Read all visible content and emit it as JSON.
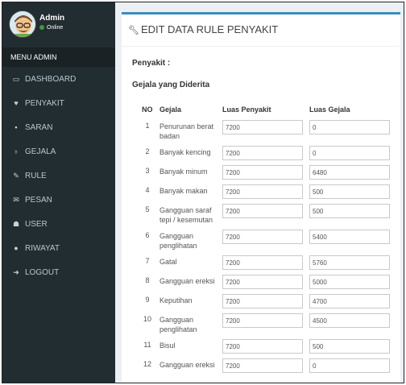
{
  "user": {
    "name": "Admin",
    "status": "Online"
  },
  "menu": {
    "header": "MENU ADMIN",
    "items": [
      {
        "label": "DASHBOARD",
        "icon": "monitor-icon",
        "glyph": "▭"
      },
      {
        "label": "PENYAKIT",
        "icon": "heartbeat-icon",
        "glyph": "♥"
      },
      {
        "label": "SARAN",
        "icon": "briefcase-icon",
        "glyph": "▪"
      },
      {
        "label": "GEJALA",
        "icon": "stethoscope-icon",
        "glyph": "♁"
      },
      {
        "label": "RULE",
        "icon": "wrench-icon",
        "glyph": "✎"
      },
      {
        "label": "PESAN",
        "icon": "envelope-icon",
        "glyph": "✉"
      },
      {
        "label": "USER",
        "icon": "users-icon",
        "glyph": "☗"
      },
      {
        "label": "RIWAYAT",
        "icon": "circle-icon",
        "glyph": "●"
      },
      {
        "label": "LOGOUT",
        "icon": "sign-out-icon",
        "glyph": "➜"
      }
    ]
  },
  "page": {
    "title": "EDIT DATA RULE PENYAKIT",
    "penyakit_label": "Penyakit :",
    "gejala_label": "Gejala yang Diderita"
  },
  "table": {
    "headers": [
      "NO",
      "Gejala",
      "Luas Penyakit",
      "Luas Gejala"
    ],
    "rows": [
      {
        "no": "1",
        "gejala": "Penurunan berat badan",
        "luas_penyakit": "7200",
        "luas_gejala": "0"
      },
      {
        "no": "2",
        "gejala": "Banyak kencing",
        "luas_penyakit": "7200",
        "luas_gejala": "0"
      },
      {
        "no": "3",
        "gejala": "Banyak minum",
        "luas_penyakit": "7200",
        "luas_gejala": "6480"
      },
      {
        "no": "4",
        "gejala": "Banyak makan",
        "luas_penyakit": "7200",
        "luas_gejala": "500"
      },
      {
        "no": "5",
        "gejala": "Gangguan saraf tepi / kesemutan",
        "luas_penyakit": "7200",
        "luas_gejala": "500"
      },
      {
        "no": "6",
        "gejala": "Gangguan penglihatan",
        "luas_penyakit": "7200",
        "luas_gejala": "5400"
      },
      {
        "no": "7",
        "gejala": "Gatal",
        "luas_penyakit": "7200",
        "luas_gejala": "5760"
      },
      {
        "no": "8",
        "gejala": "Gangguan ereksi",
        "luas_penyakit": "7200",
        "luas_gejala": "5000"
      },
      {
        "no": "9",
        "gejala": "Keputihan",
        "luas_penyakit": "7200",
        "luas_gejala": "4700"
      },
      {
        "no": "10",
        "gejala": "Gangguan penglihatan",
        "luas_penyakit": "7200",
        "luas_gejala": "4500"
      },
      {
        "no": "11",
        "gejala": "Bisul",
        "luas_penyakit": "7200",
        "luas_gejala": "500"
      },
      {
        "no": "12",
        "gejala": "Gangguan ereksi",
        "luas_penyakit": "7200",
        "luas_gejala": "0"
      }
    ]
  }
}
